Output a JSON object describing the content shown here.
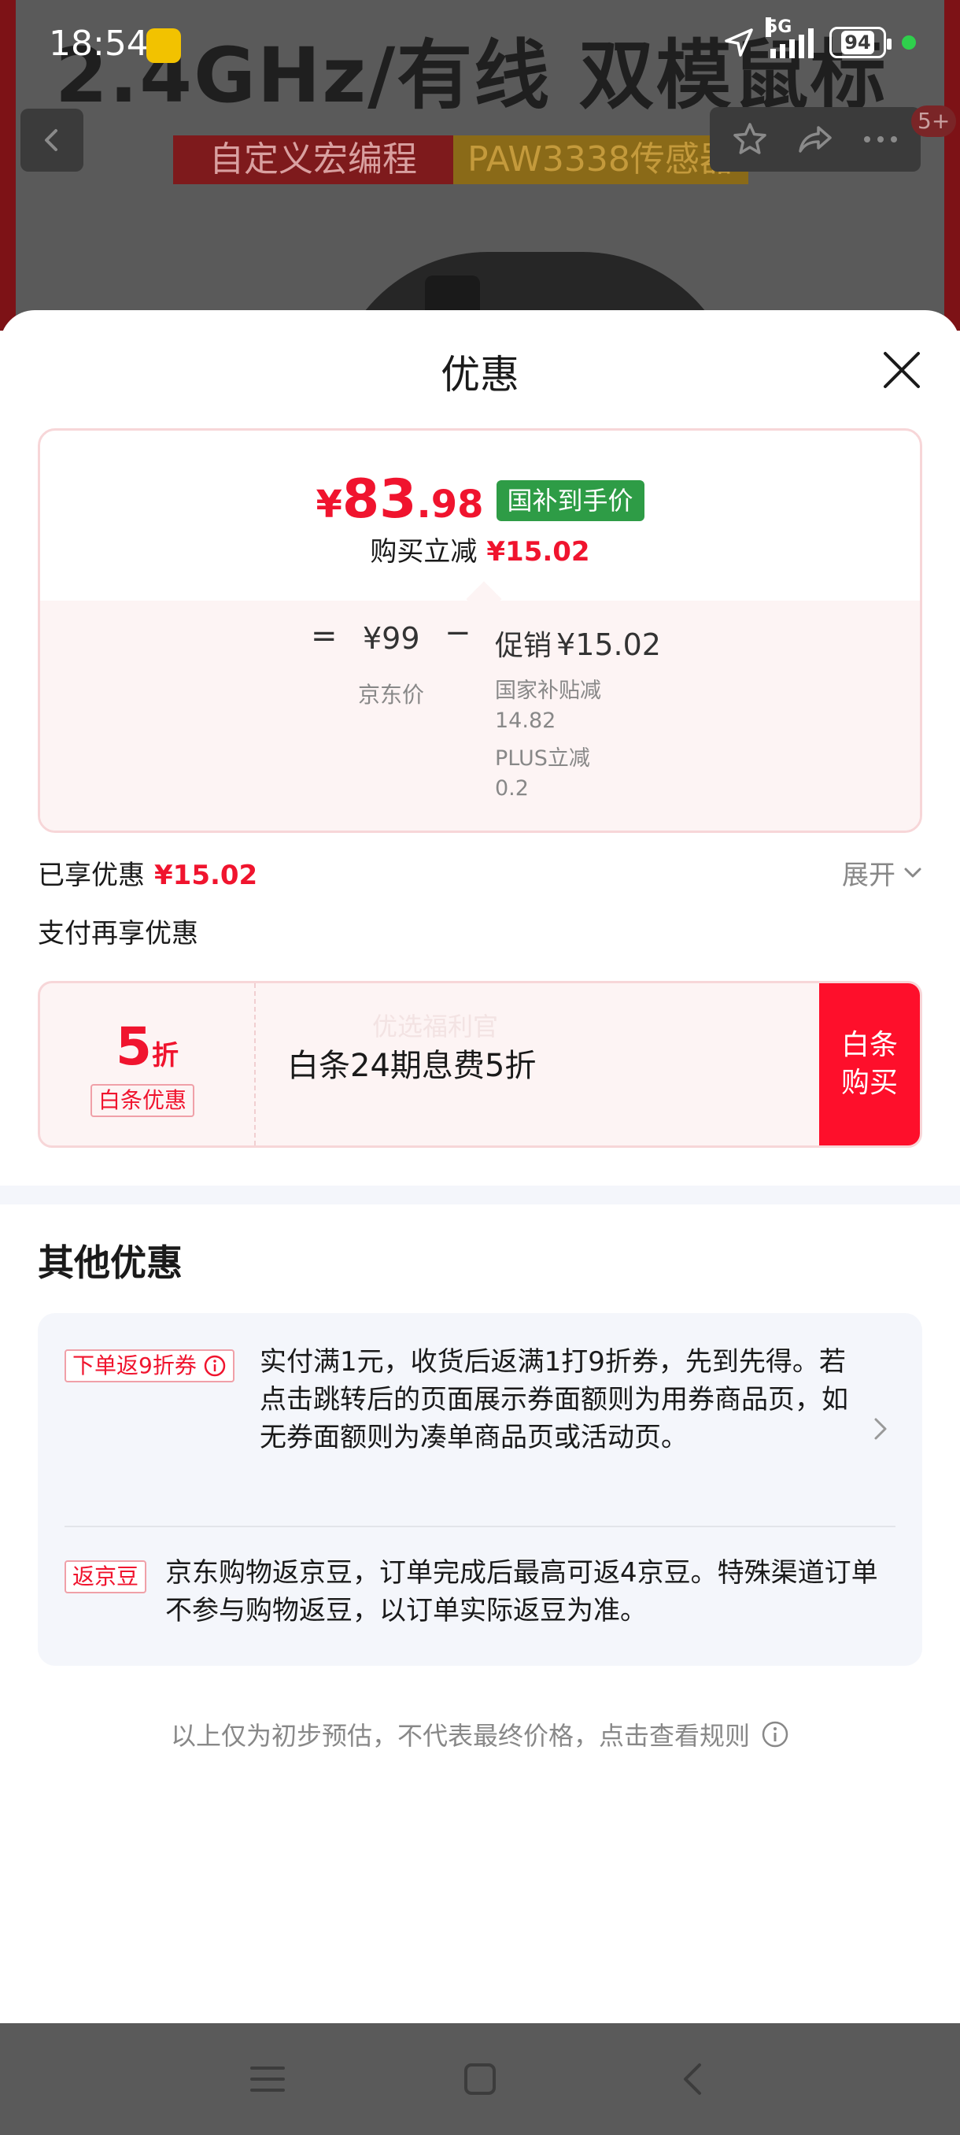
{
  "status_bar": {
    "time": "18:54",
    "network": "5G",
    "battery": "94",
    "colors": {
      "charging_dot": "#2fcf4c"
    }
  },
  "background_page": {
    "headline": "2.4GHz/有线 双模鼠标",
    "tag_macro": "自定义宏编程",
    "tag_sensor": "PAW3338传感器",
    "notification_count": "5+",
    "icons": [
      "back-icon",
      "star-icon",
      "share-icon",
      "more-icon"
    ]
  },
  "sheet": {
    "title": "优惠",
    "close_icon": "close-icon"
  },
  "price_card": {
    "currency": "¥",
    "price_int": "83",
    "price_dec": ".98",
    "subsidy_tag": "国补到手价",
    "instant_label": "购买立减",
    "instant_amount": "¥15.02",
    "equals": "=",
    "jd_price": "¥99",
    "jd_price_label": "京东价",
    "minus": "−",
    "promo_label": "促销",
    "promo_amount": "¥15.02",
    "promo_sub1_label": "国家补贴减",
    "promo_sub1_value": "14.82",
    "promo_sub2_label": "PLUS立减",
    "promo_sub2_value": "0.2",
    "colors": {
      "price_red": "#f0142e",
      "subsidy_green": "#2e9c46"
    }
  },
  "enjoyed": {
    "label": "已享优惠",
    "amount": "¥15.02",
    "expand_label": "展开"
  },
  "payment": {
    "section_label": "支付再享优惠",
    "discount_num": "5",
    "discount_unit": "折",
    "badge": "白条优惠",
    "watermark": "优选福利官",
    "description": "白条24期息费5折",
    "buy_line1": "白条",
    "buy_line2": "购买",
    "colors": {
      "buy_button": "#fe0f2b"
    }
  },
  "other_offers": {
    "title": "其他优惠",
    "items": [
      {
        "tag": "下单返9折券",
        "text": "实付满1元，收货后返满1打9折券，先到先得。若点击跳转后的页面展示券面额则为用券商品页，如无券面额则为凑单商品页或活动页。"
      },
      {
        "tag": "返京豆",
        "text": "京东购物返京豆，订单完成后最高可返4京豆。特殊渠道订单不参与购物返豆，以订单实际返豆为准。"
      }
    ]
  },
  "disclaimer": "以上仅为初步预估，不代表最终价格，点击查看规则"
}
